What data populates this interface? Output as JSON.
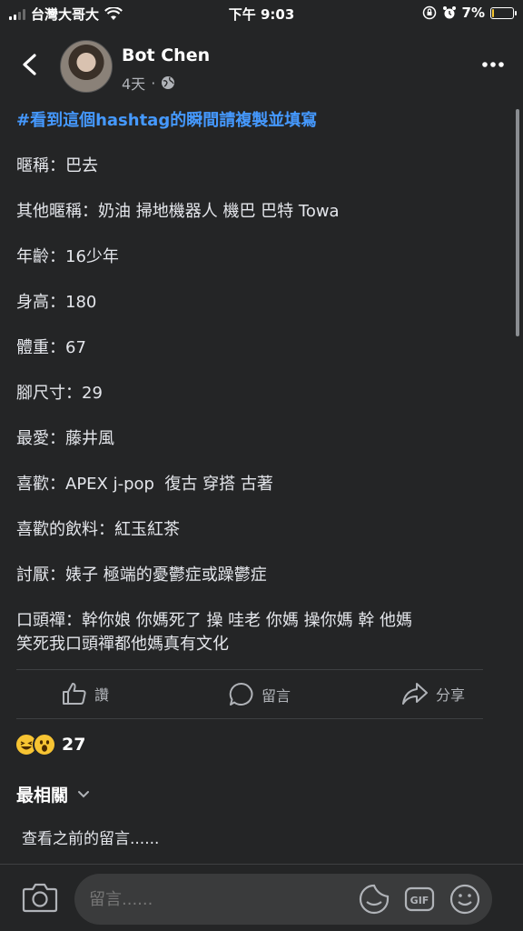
{
  "status_bar": {
    "carrier": "台灣大哥大",
    "time": "下午 9:03",
    "battery": "7%",
    "battery_level": 0.07
  },
  "header": {
    "author": "Bot Chen",
    "time_ago": "4天",
    "separator": "·"
  },
  "post": {
    "hashtag": "#看到這個hashtag的瞬間請複製並填寫",
    "lines": [
      "暱稱：巴去",
      "其他暱稱：奶油 掃地機器人 機巴 巴特 Towa",
      "年齡：16少年",
      "身高：180",
      "體重：67",
      "腳尺寸：29",
      "最愛：藤井風",
      "喜歡：APEX j-pop  復古 穿搭 古著",
      "喜歡的飲料：紅玉紅茶",
      "討厭：婊子 極端的憂鬱症或躁鬱症",
      "口頭禪：幹你娘 你媽死了 操 哇老 你媽 操你媽 幹 他媽",
      "笑死我口頭禪都他媽真有文化"
    ]
  },
  "actions": {
    "like": "讚",
    "comment": "留言",
    "share": "分享"
  },
  "reactions": {
    "count": "27"
  },
  "comments": {
    "sort_label": "最相關",
    "view_previous": "查看之前的留言......"
  },
  "composer": {
    "placeholder": "留言......"
  }
}
